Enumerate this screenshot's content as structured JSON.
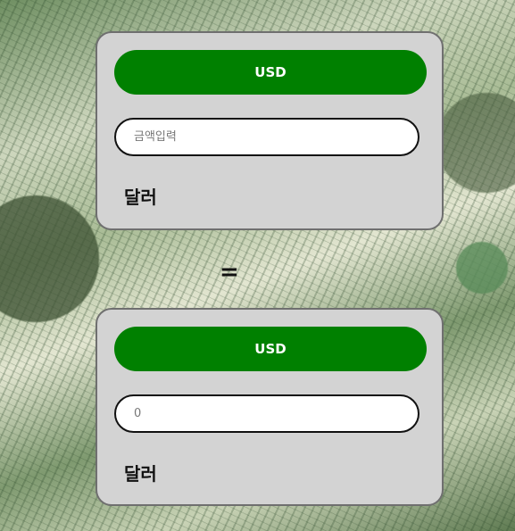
{
  "converter": {
    "from": {
      "currency_label": "USD",
      "amount_placeholder": "금액입력",
      "amount_value": "",
      "unit_label": "달러"
    },
    "equals_sign": "=",
    "to": {
      "currency_label": "USD",
      "amount_placeholder": "0",
      "amount_value": "",
      "unit_label": "달러"
    }
  },
  "colors": {
    "button_green": "#008000",
    "card_gray": "#d3d3d3"
  }
}
